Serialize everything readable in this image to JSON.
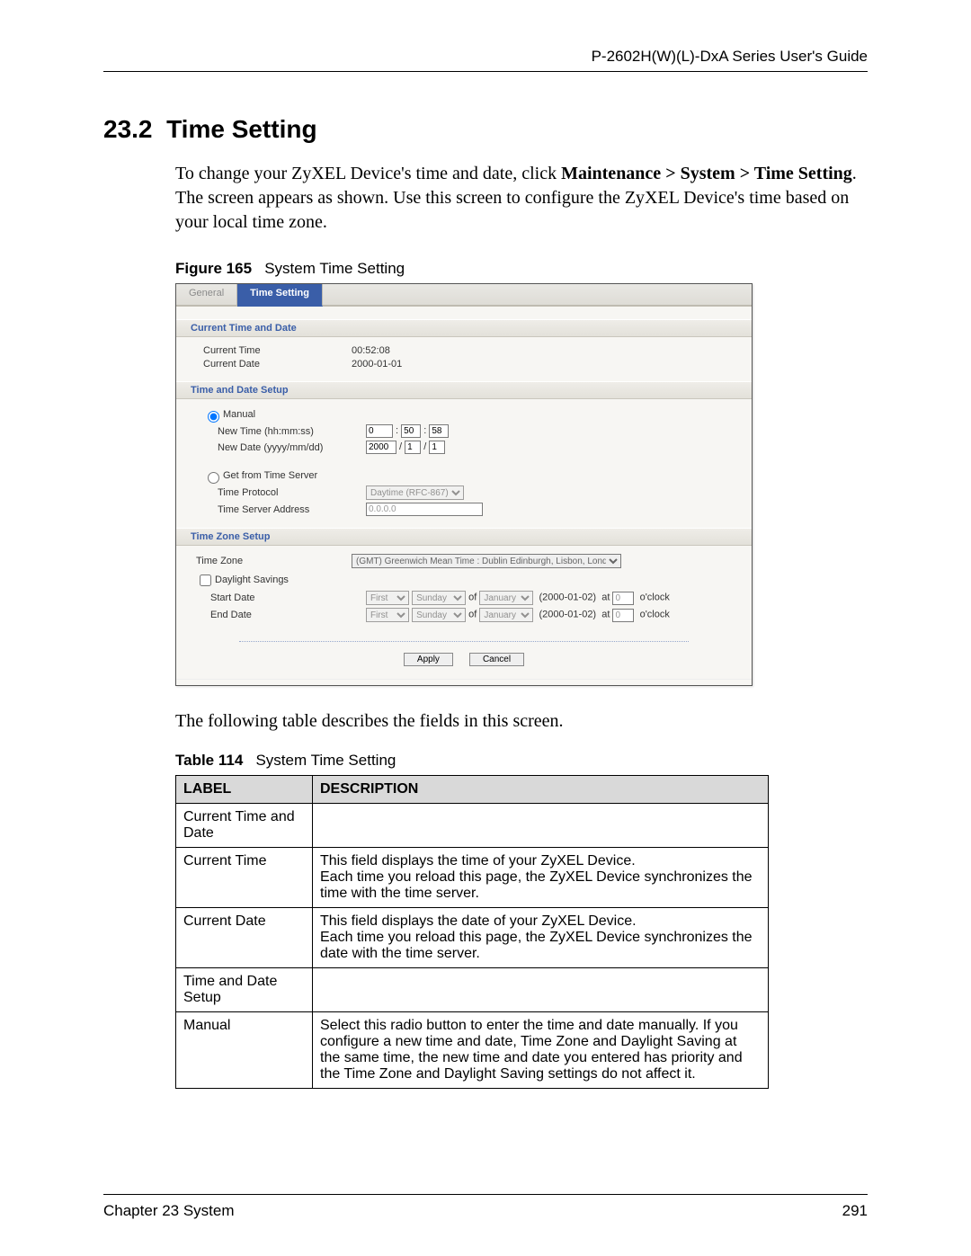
{
  "doc": {
    "guide_title": "P-2602H(W)(L)-DxA Series User's Guide",
    "section_number": "23.2",
    "section_title": "Time Setting",
    "intro_pre": "To change your ZyXEL Device's time and date, click ",
    "intro_bold": "Maintenance > System > Time Setting",
    "intro_post": ". The screen appears as shown. Use this screen to configure the ZyXEL Device's time based on your local time zone.",
    "figure_label": "Figure 165",
    "figure_title": "System Time Setting",
    "following_text": "The following table describes the fields in this screen.",
    "table_label": "Table 114",
    "table_title": "System Time Setting",
    "chapter_footer": "Chapter 23 System",
    "page_number": "291"
  },
  "ui": {
    "tabs": {
      "general": "General",
      "time_setting": "Time Setting"
    },
    "sections": {
      "current": "Current Time and Date",
      "setup": "Time and Date Setup",
      "tz": "Time Zone Setup"
    },
    "labels": {
      "current_time": "Current Time",
      "current_date": "Current Date",
      "manual": "Manual",
      "new_time": "New Time (hh:mm:ss)",
      "new_date": "New Date (yyyy/mm/dd)",
      "get_from": "Get from Time Server",
      "time_protocol": "Time Protocol",
      "server_addr": "Time Server Address",
      "time_zone": "Time Zone",
      "daylight": "Daylight Savings",
      "start_date": "Start Date",
      "end_date": "End Date",
      "of": "of",
      "at": "at",
      "oclock": "o'clock"
    },
    "values": {
      "current_time": "00:52:08",
      "current_date": "2000-01-01",
      "hh": "0",
      "mm": "50",
      "ss": "58",
      "yyyy": "2000",
      "mon": "1",
      "dd": "1",
      "protocol": "Daytime (RFC-867)",
      "server_addr": "0.0.0.0",
      "tz": "(GMT) Greenwich Mean Time : Dublin Edinburgh, Lisbon, London",
      "ord": "First",
      "day": "Sunday",
      "month": "January",
      "dst_date": "(2000-01-02)",
      "dst_hour": "0"
    },
    "buttons": {
      "apply": "Apply",
      "cancel": "Cancel"
    }
  },
  "table": {
    "th_label": "LABEL",
    "th_desc": "DESCRIPTION",
    "rows": {
      "r1l": "Current Time and Date",
      "r1d": "",
      "r2l": "Current Time",
      "r2d1": "This field displays the time of your ZyXEL Device.",
      "r2d2": "Each time you reload this page, the ZyXEL Device synchronizes the time with the time server.",
      "r3l": "Current Date",
      "r3d1": "This field displays the date of your ZyXEL Device.",
      "r3d2": "Each time you reload this page, the ZyXEL Device synchronizes the date with the time server.",
      "r4l": "Time and Date Setup",
      "r4d": "",
      "r5l": "Manual",
      "r5d": "Select this radio button to enter the time and date manually. If you configure a new time and date, Time Zone and Daylight Saving at the same time, the new time and date you entered has priority and the Time Zone and Daylight Saving settings do not affect it."
    }
  }
}
